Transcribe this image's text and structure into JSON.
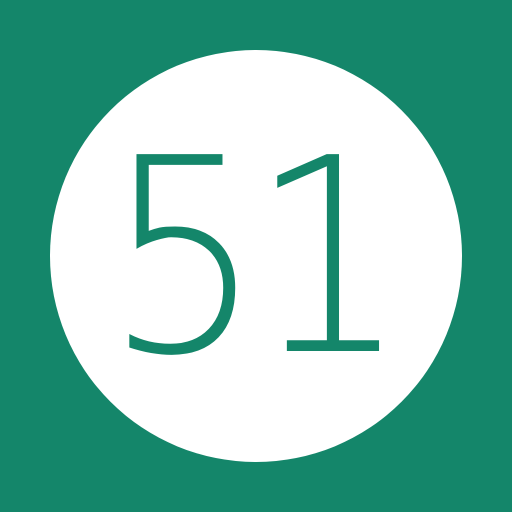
{
  "icon": {
    "label": "51",
    "background_color": "#14866a",
    "circle_color": "#ffffff",
    "text_color": "#14866a"
  }
}
